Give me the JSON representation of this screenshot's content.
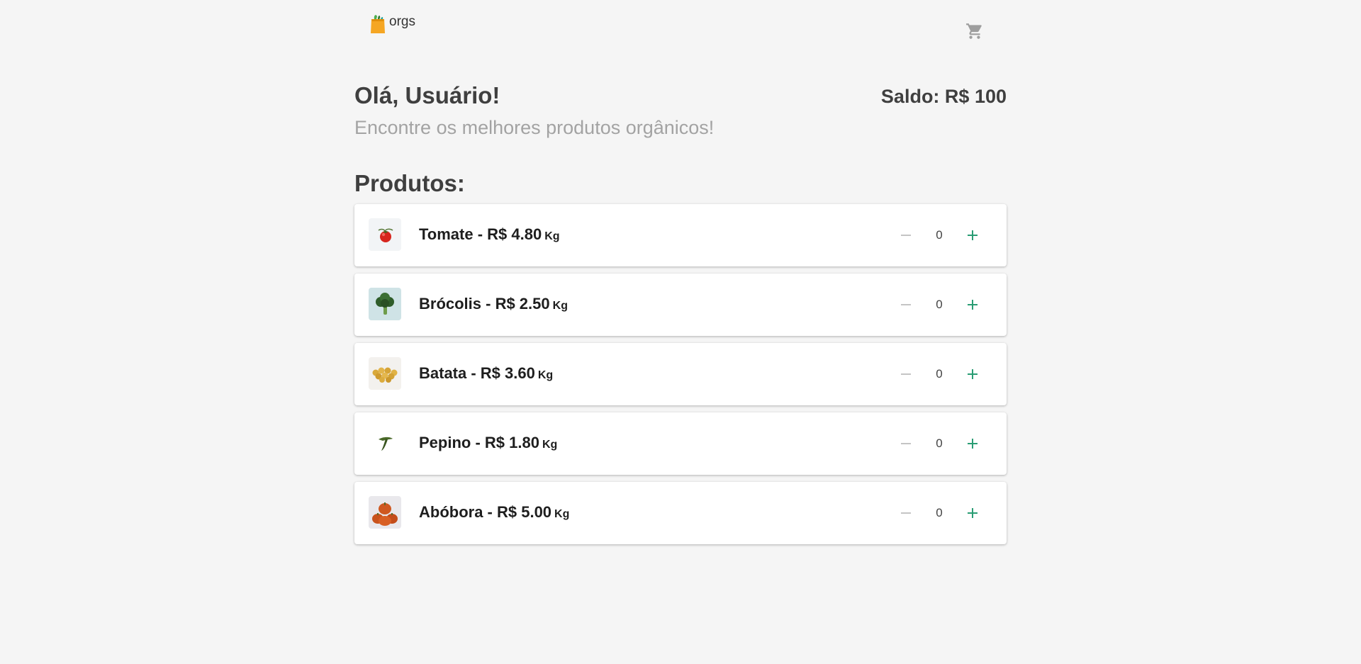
{
  "header": {
    "logo_text": "orgs",
    "logo_icon": "shopping-bag-icon",
    "cart_icon": "cart-icon"
  },
  "greeting": "Olá, Usuário!",
  "balance": {
    "label": "Saldo: R$ 100"
  },
  "subtitle": "Encontre os melhores produtos orgânicos!",
  "products_title": "Produtos:",
  "products": [
    {
      "name": "Tomate - R$ 4.80",
      "unit": "Kg",
      "quantity": "0",
      "icon": "tomato-icon"
    },
    {
      "name": "Brócolis - R$ 2.50",
      "unit": "Kg",
      "quantity": "0",
      "icon": "broccoli-icon"
    },
    {
      "name": "Batata - R$ 3.60",
      "unit": "Kg",
      "quantity": "0",
      "icon": "potato-icon"
    },
    {
      "name": "Pepino - R$ 1.80",
      "unit": "Kg",
      "quantity": "0",
      "icon": "cucumber-icon"
    },
    {
      "name": "Abóbora - R$ 5.00",
      "unit": "Kg",
      "quantity": "0",
      "icon": "pumpkin-icon"
    }
  ],
  "colors": {
    "background": "#f5f5f5",
    "card": "#ffffff",
    "accent_plus": "#2a9d74",
    "minus_disabled": "#b5b5b5",
    "text_dark": "#3f3f3f",
    "text_muted": "#a3a3a3"
  }
}
